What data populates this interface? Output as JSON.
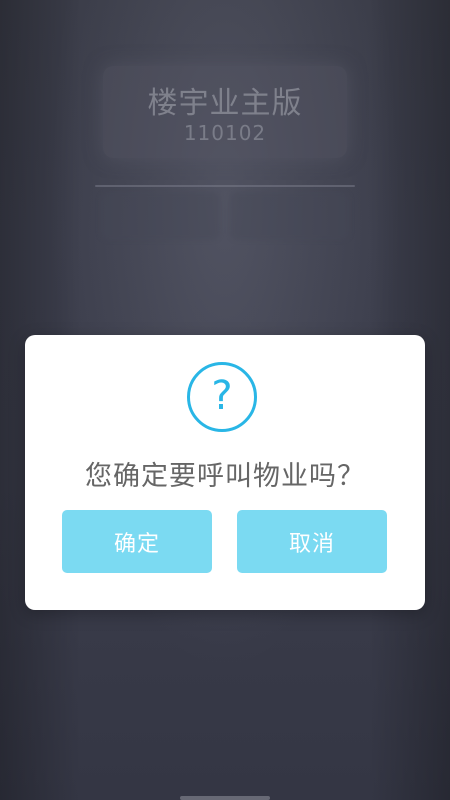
{
  "header": {
    "title": "楼宇业主版",
    "code": "110102"
  },
  "dialog": {
    "icon": "question-circle-icon",
    "message": "您确定要呼叫物业吗？",
    "confirm_label": "确定",
    "cancel_label": "取消",
    "accent_color": "#29b6e6",
    "button_color": "#7bdaf2"
  }
}
